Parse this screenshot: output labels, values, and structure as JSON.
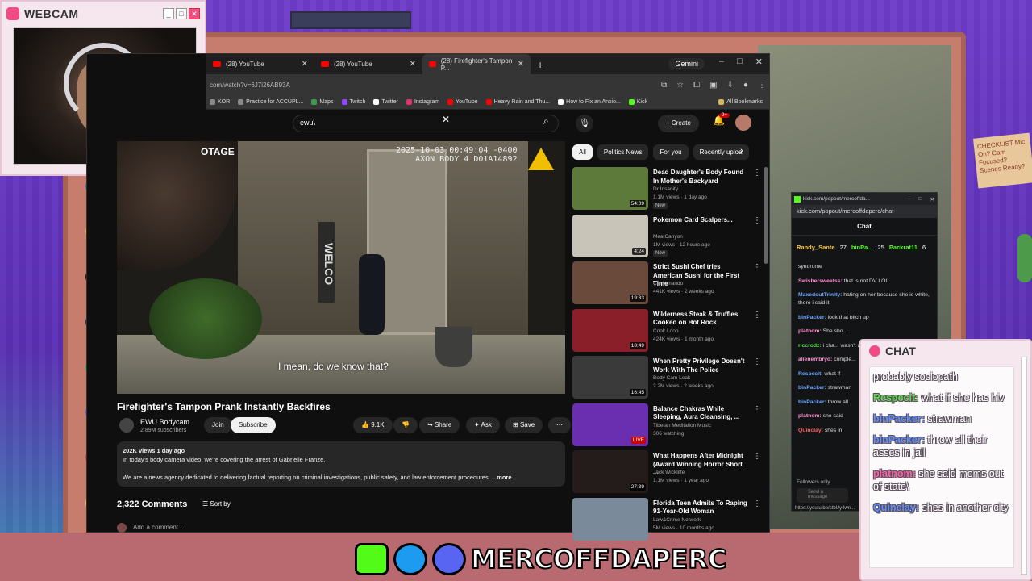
{
  "webcam": {
    "title": "WEBCAM",
    "buttons": [
      "_",
      "□",
      "✕"
    ]
  },
  "browser": {
    "tabs": [
      {
        "label": "(28) YouTube"
      },
      {
        "label": "(28) YouTube"
      },
      {
        "label": "(28) Firefighter's Tampon P..."
      }
    ],
    "gemini": "Gemini",
    "url": "com/watch?v=6J7i26AB93A",
    "bookmarks": [
      "KOR",
      "Practice for ACCUPL...",
      "Maps",
      "Twitch",
      "Twitter",
      "Instagram",
      "YouTube",
      "Heavy Rain and Thu...",
      "How to Fix an Anxio...",
      "Kick"
    ],
    "all_bookmarks": "All Bookmarks"
  },
  "youtube": {
    "search_value": "ewu\\",
    "create_label": "Create",
    "notif_count": "9+",
    "video": {
      "title": "Firefighter's Tampon Prank Instantly Backfires",
      "osd_line1": "2025-10-03 00:49:04 -0400",
      "osd_line2": "AXON BODY 4 D01A14892",
      "corner_text": "OTAGE",
      "welcome_sign": "WELCO",
      "caption": "I mean, do we know that?"
    },
    "channel": {
      "name": "EWU Bodycam",
      "subs": "2.89M subscribers",
      "join": "Join",
      "subscribe": "Subscribe"
    },
    "actions": {
      "likes": "9.1K",
      "share": "Share",
      "ask": "Ask",
      "save": "Save"
    },
    "description": {
      "meta": "202K views  1 day ago",
      "line1": "In today's body camera video, we're covering the arrest of Gabrielle Franze.",
      "line2": "We are a news agency dedicated to delivering factual reporting on criminal investigations, public safety, and law enforcement procedures.",
      "more": "...more"
    },
    "comments": {
      "count": "2,322 Comments",
      "sort": "Sort by",
      "add": "Add a comment..."
    },
    "chips": [
      "All",
      "Politics News",
      "For you",
      "Recently uploa"
    ],
    "recommendations": [
      {
        "title": "Dead Daughter's Body Found In Mother's Backyard",
        "channel": "Dr Insanity",
        "meta": "1.1M views · 1 day ago",
        "badge": "New",
        "duration": "54:09",
        "color": "#5d7a3a"
      },
      {
        "title": "Pokemon Card Scalpers...",
        "channel": "MeatCanyon",
        "meta": "1M views · 12 hours ago",
        "badge": "New",
        "duration": "4:24",
        "color": "#c8c4b8"
      },
      {
        "title": "Strict Sushi Chef tries American Sushi for the First Time",
        "channel": "Cantomando",
        "meta": "441K views · 2 weeks ago",
        "badge": "",
        "duration": "19:33",
        "color": "#6a4a3a"
      },
      {
        "title": "Wilderness Steak & Truffles Cooked on Hot Rock",
        "channel": "Cook Loop",
        "meta": "424K views · 1 month ago",
        "badge": "",
        "duration": "18:49",
        "color": "#8a1f2a"
      },
      {
        "title": "When Pretty Privilege Doesn't Work With The Police",
        "channel": "Body Cam Leak",
        "meta": "2.2M views · 2 weeks ago",
        "badge": "",
        "duration": "16:45",
        "color": "#3a3a3a"
      },
      {
        "title": "Balance Chakras While Sleeping, Aura Cleansing, ...",
        "channel": "Tibetan Meditation Music",
        "meta": "306 watching",
        "badge": "",
        "duration": "LIVE",
        "color": "#6a2fb0"
      },
      {
        "title": "What Happens After Midnight (Award Winning Horror Short ...",
        "channel": "Jack Wickliffe",
        "meta": "1.1M views · 1 year ago",
        "badge": "",
        "duration": "27:39",
        "color": "#241c1a"
      },
      {
        "title": "Florida Teen Admits To Raping 91-Year-Old Woman",
        "channel": "Law&Crime Network",
        "meta": "5M views · 10 months ago",
        "badge": "",
        "duration": "",
        "color": "#7a8a9a"
      }
    ]
  },
  "kick": {
    "tab_label": "kick.com/popout/mercoffda...",
    "url": "kick.com/popout/mercoffdaperc/chat",
    "header": "Chat",
    "pins": {
      "user1": "Randy_Sante",
      "count1": "27",
      "user2": "binPa...",
      "count2": "25",
      "user3": "Packrat11",
      "count3": "6"
    },
    "messages": [
      {
        "user": "",
        "text": "syndrome"
      },
      {
        "user": "Swishersweetss:",
        "text": "that is not DV LOL"
      },
      {
        "user": "MaxedoutTrinity:",
        "text": "hating on her because she is white, there i said it"
      },
      {
        "user": "binPacker:",
        "text": "lock that bitch up"
      },
      {
        "user": "platnom:",
        "text": "She sho..."
      },
      {
        "user": "riccrodz:",
        "text": "i cha... wasn't used"
      },
      {
        "user": "alienembryo:",
        "text": "comple..."
      },
      {
        "user": "Respecit:",
        "text": "what if"
      },
      {
        "user": "binPacker:",
        "text": "strawman"
      },
      {
        "user": "binPacker:",
        "text": "throw all"
      },
      {
        "user": "platnom:",
        "text": "she said"
      },
      {
        "user": "Quinclay:",
        "text": "shes in"
      }
    ],
    "followers_only": "Followers only",
    "send_placeholder": "Send a message",
    "status_url": "https://youtu.be/stbUy4wn..."
  },
  "chat_overlay": {
    "title": "CHAT",
    "messages": [
      {
        "user": "",
        "text": "probably sociopath",
        "color": "blue"
      },
      {
        "user": "Respecit:",
        "text": "what if she has hiv",
        "color": "green"
      },
      {
        "user": "binPacker:",
        "text": "strawman",
        "color": "blue"
      },
      {
        "user": "binPacker:",
        "text": "throw all their asses in jail",
        "color": "blue"
      },
      {
        "user": "platnom:",
        "text": "she said moms out of state\\",
        "color": "pink"
      },
      {
        "user": "Quinclay:",
        "text": "shes in another city",
        "color": "blue"
      }
    ]
  },
  "banner": {
    "text": "MERCOFFDAPERC"
  },
  "decor": {
    "note_text": "CHECKLIST Mic On? Cam Focused? Scenes Ready?"
  },
  "colors": {
    "yt_bg": "#0f0f0f",
    "kick_green": "#53fc18",
    "accent_pink": "#f04b84"
  }
}
